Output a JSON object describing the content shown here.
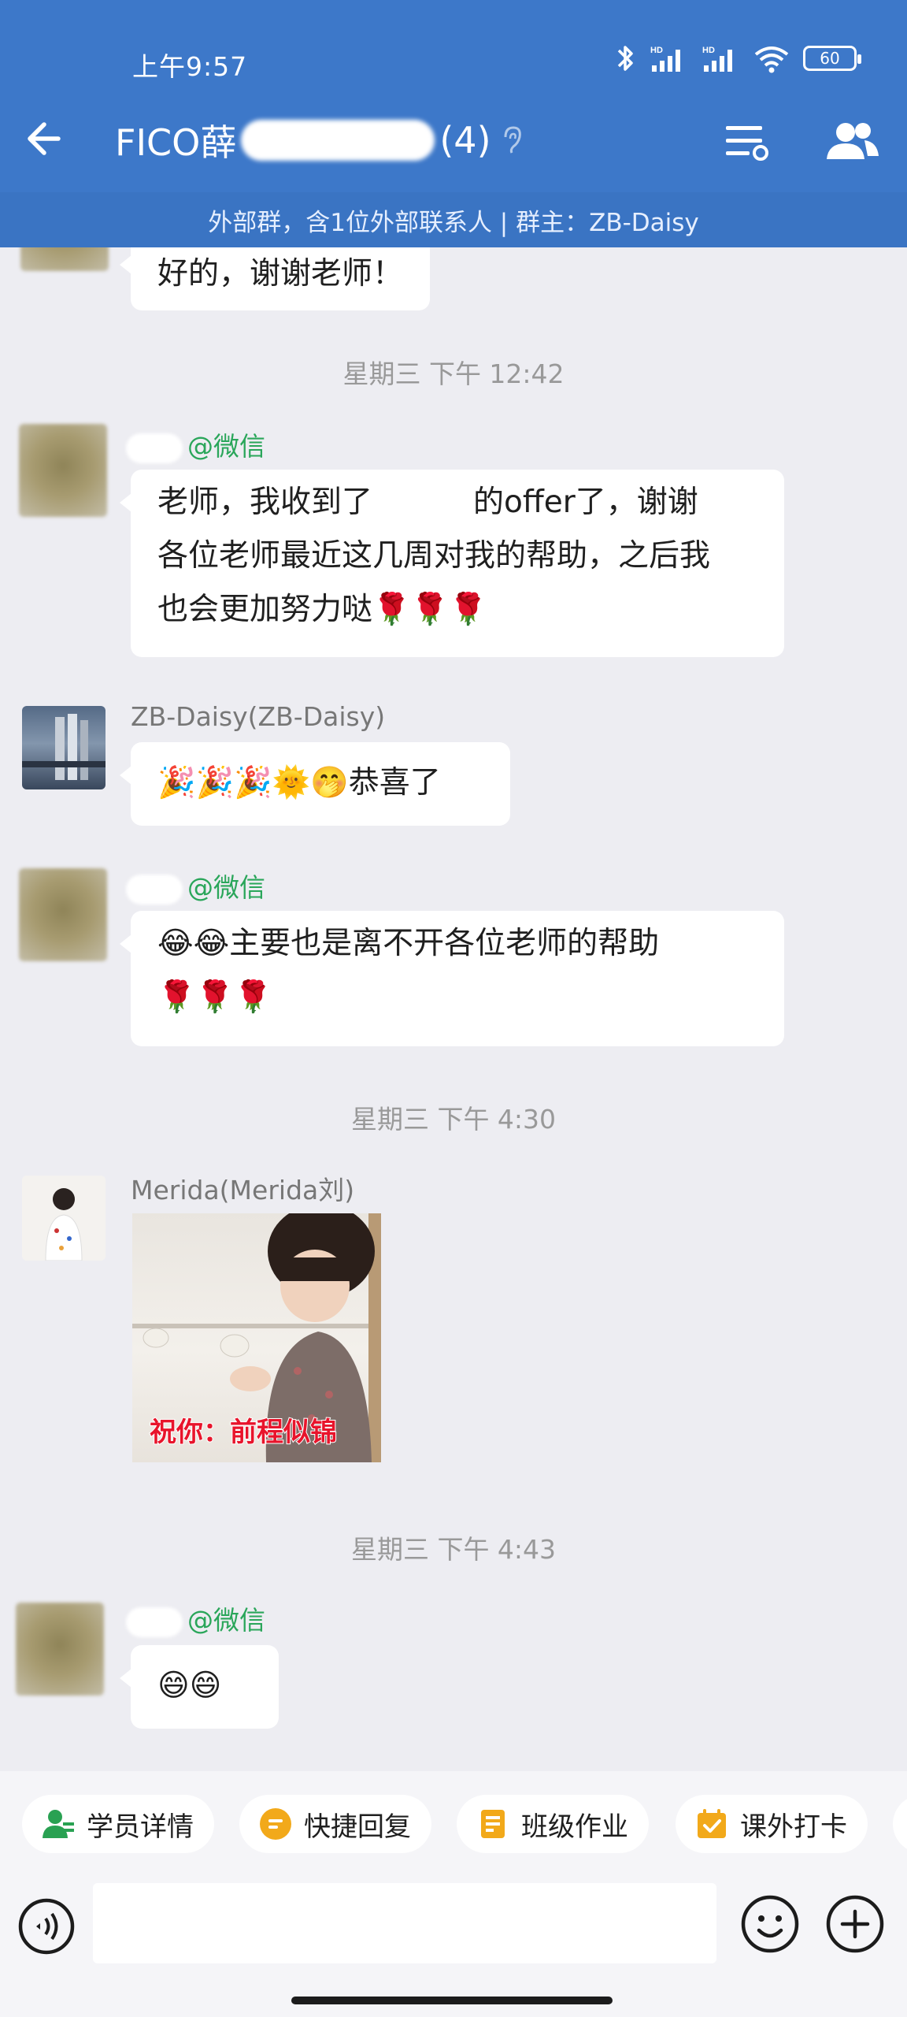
{
  "status": {
    "time": "上午9:57",
    "battery": "60"
  },
  "header": {
    "title_prefix": "FICO薛",
    "count": "(4)"
  },
  "banner": "外部群，含1位外部联系人 | 群主：ZB-Daisy",
  "messages": [
    {
      "text": "好的，谢谢老师！"
    },
    {
      "sender_tag": "@微信",
      "text_a": "老师，我收到了",
      "text_b": "的offer了，谢谢",
      "text_c": "各位老师最近这几周对我的帮助，之后我",
      "text_d": "也会更加努力哒🌹🌹🌹"
    },
    {
      "sender": "ZB-Daisy(ZB-Daisy)",
      "text": "🎉🎉🎉🌞🤭恭喜了"
    },
    {
      "sender_tag": "@微信",
      "text_a": "😂😂主要也是离不开各位老师的帮助",
      "text_b": "🌹🌹🌹"
    },
    {
      "sender": "Merida(Merida刘)",
      "image_caption": "祝你：前程似锦"
    },
    {
      "sender_tag": "@微信",
      "text": "😄😄"
    }
  ],
  "timestamps": [
    "星期三  下午 12:42",
    "星期三  下午 4:30",
    "星期三  下午 4:43"
  ],
  "quick_actions": [
    "学员详情",
    "快捷回复",
    "班级作业",
    "课外打卡"
  ],
  "input": {
    "placeholder": ""
  },
  "icons": {
    "back": "back-arrow-icon",
    "menu": "menu-icon",
    "members": "members-icon",
    "voice": "voice-icon",
    "emoji": "emoji-icon",
    "plus": "plus-icon"
  },
  "colors": {
    "header": "#3d78c9",
    "banner": "#3a74c3",
    "wechat_tag": "#2aa65a",
    "background": "#ededf2"
  }
}
